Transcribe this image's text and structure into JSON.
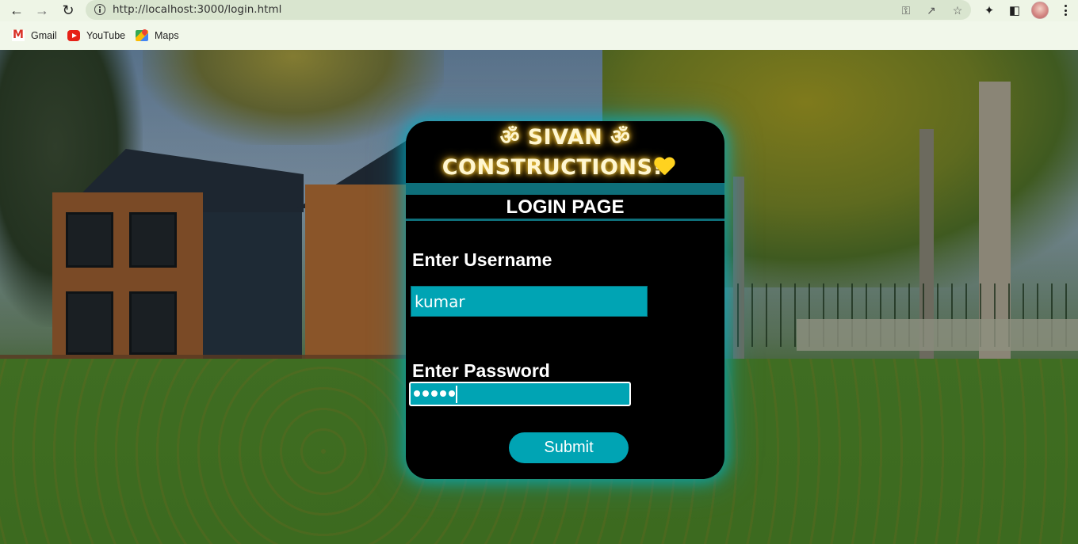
{
  "browser": {
    "url": "http://localhost:3000/login.html",
    "bookmarks": [
      {
        "label": "Gmail"
      },
      {
        "label": "YouTube"
      },
      {
        "label": "Maps"
      }
    ]
  },
  "card": {
    "brand_line1": "ॐ SIVAN ॐ",
    "brand_line2": "CONSTRUCTIONS!",
    "title": "LOGIN PAGE",
    "username_label": "Enter Username",
    "username_value": "kumar",
    "password_label": "Enter Password",
    "password_masked_length": 5,
    "submit_label": "Submit"
  },
  "colors": {
    "accent": "#00a4b4",
    "glow": "#00b4c8",
    "brand_glow": "#ffd54a",
    "card_bg": "#000000"
  }
}
